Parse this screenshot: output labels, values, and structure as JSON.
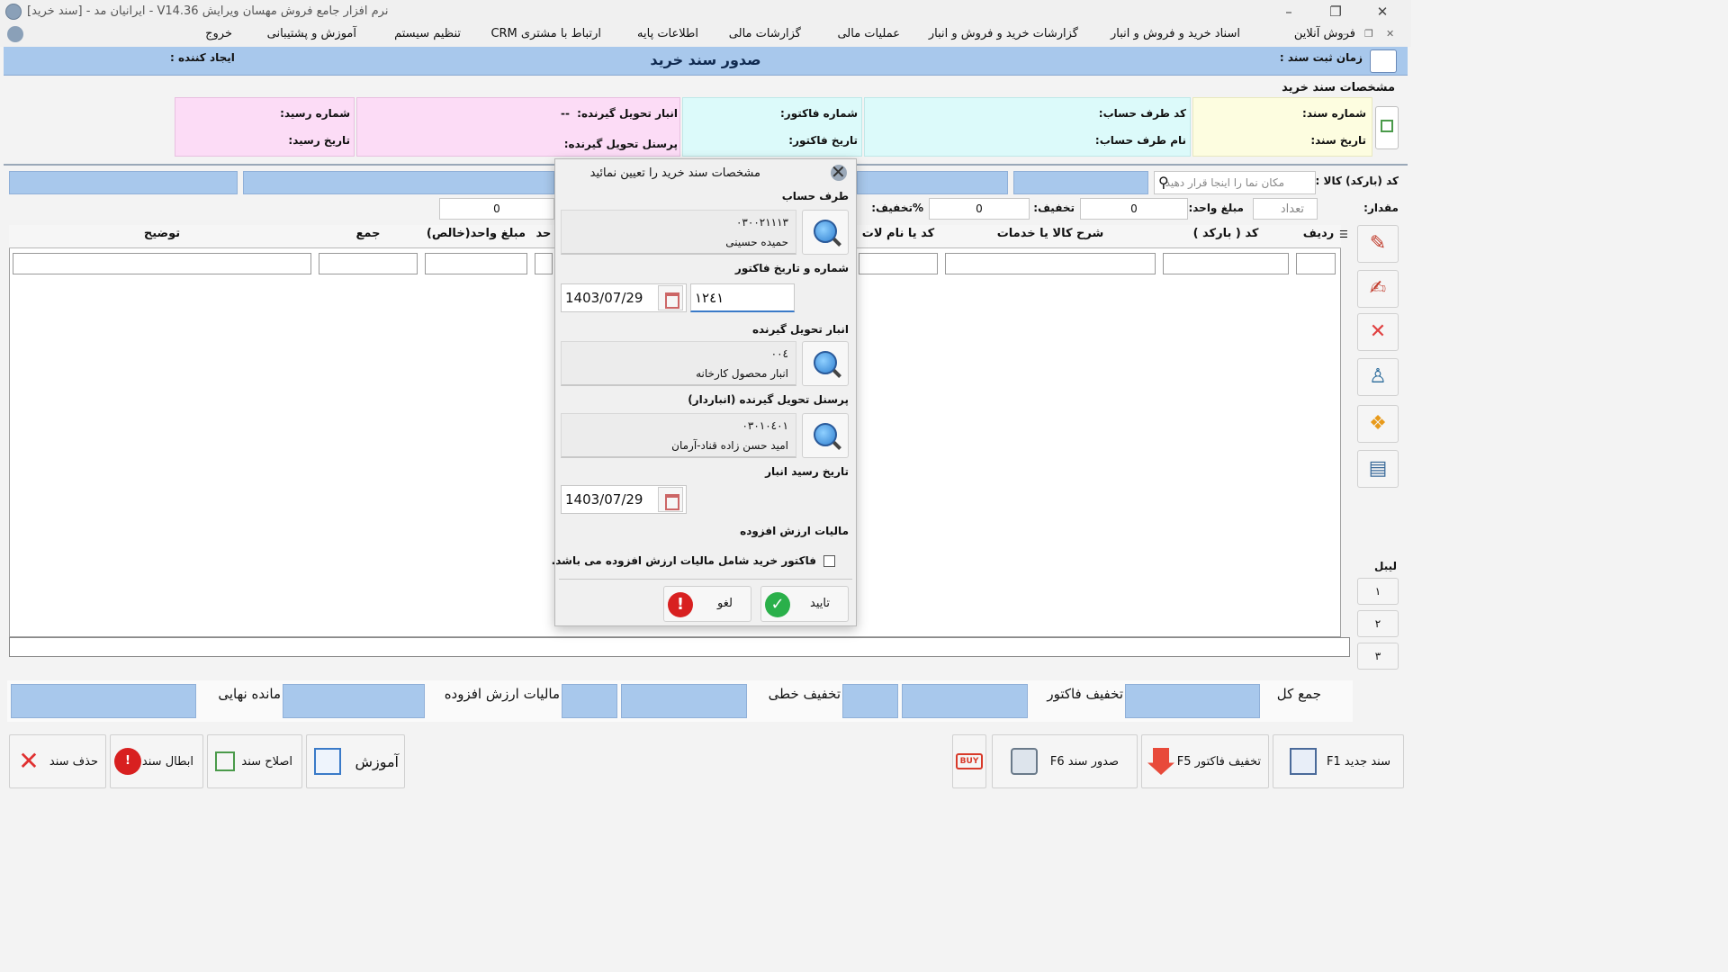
{
  "window": {
    "title": "نرم افزار جامع فروش مهسان ویرایش V14.36 - ایرانیان مد - [سند خرید]"
  },
  "menu": {
    "items": [
      "فروش آنلاین",
      "اسناد خرید و فروش و انبار",
      "گزارشات خرید و فروش و انبار",
      "عملیات مالی",
      "گزارشات مالی",
      "اطلاعات پایه",
      "ارتباط با مشتری CRM",
      "تنظیم سیستم",
      "آموزش و پشتیبانی",
      "خروج"
    ]
  },
  "header": {
    "title": "صدور سند خرید",
    "reg_time_label": "زمان ثبت سند :",
    "creator_label": "ایجاد کننده :"
  },
  "spec": {
    "title": "مشخصات سند خرید",
    "doc_number_label": "شماره سند:",
    "doc_date_label": "تاریخ سند:",
    "party_code_label": "کد طرف حساب:",
    "party_name_label": "نام طرف حساب:",
    "invoice_number_label": "شماره فاکتور:",
    "invoice_date_label": "تاریخ فاکتور:",
    "warehouse_label": "انبار تحویل گیرنده:",
    "warehouse_value": "--",
    "personnel_label": "پرسنل تحویل گیرنده:",
    "receipt_number_label": "شماره رسید:",
    "receipt_date_label": "تاریخ رسید:"
  },
  "entry": {
    "barcode_label": "کد (بارکد) کالا :",
    "search_placeholder": "مکان نما را اینجا قرار دهید",
    "quantity_label": "مقدار:",
    "count_placeholder": "تعداد",
    "unit_price_label": "مبلغ واحد:",
    "unit_price_value": "0",
    "discount_label": "تخفیف:",
    "discount_value": "0",
    "discount_pct_label": "%تخفیف:",
    "total_value": "0"
  },
  "grid": {
    "columns": [
      "ردیف",
      "کد ( بارکد )",
      "شرح کالا یا خدمات",
      "کد یا نام لات",
      "حد",
      "مبلغ واحد(خالص)",
      "جمع",
      "توضیح"
    ]
  },
  "totals": {
    "total_label": "جمع کل",
    "invoice_discount_label": "تخفیف فاکتور",
    "line_discount_label": "تخفیف خطی",
    "vat_label": "مالیات ارزش افزوده",
    "final_label": "مانده نهایی"
  },
  "bottom_buttons": {
    "new_doc": "سند جدید F1",
    "invoice_discount": "تخفیف فاکتور F5",
    "issue_doc": "صدور سند F6",
    "buy_badge": "BUY",
    "training": "آموزش",
    "edit_doc": "اصلاح سند",
    "cancel_doc": "ابطال سند",
    "delete_doc": "حذف سند"
  },
  "side": {
    "label_title": "لیبل",
    "label_1": "١",
    "label_2": "٢",
    "label_3": "٣"
  },
  "dialog": {
    "title": "مشخصات سند خرید را تعیین نمائید",
    "party_section": "طرف حساب",
    "party_code": "٠٣٠٠٢١١١٣",
    "party_name": "حمیده حسینی",
    "invoice_section": "شماره و تاریخ فاکتور",
    "invoice_date": "1403/07/29",
    "invoice_number": "١٢٤١",
    "warehouse_section": "انبار تحویل گیرنده",
    "warehouse_code": "٠٠٤",
    "warehouse_name": "انبار محصول کارخانه",
    "personnel_section": "پرسنل تحویل گیرنده (انباردار)",
    "personnel_code": "٠٣٠١٠٤٠١",
    "personnel_name": "امید حسن زاده قناد-آرمان",
    "receipt_date_section": "تاریخ رسید انبار",
    "receipt_date": "1403/07/29",
    "vat_section": "مالیات ارزش افزوده",
    "vat_checkbox_label": "فاکتور خرید شامل مالیات ارزش افزوده می باشد.",
    "confirm": "تایید",
    "cancel": "لغو"
  },
  "colors": {
    "header_blue": "#a8c8ec",
    "panel_yellow": "#fdfde0",
    "panel_cyan": "#dcfafa",
    "panel_pink": "#fcdcf6"
  }
}
